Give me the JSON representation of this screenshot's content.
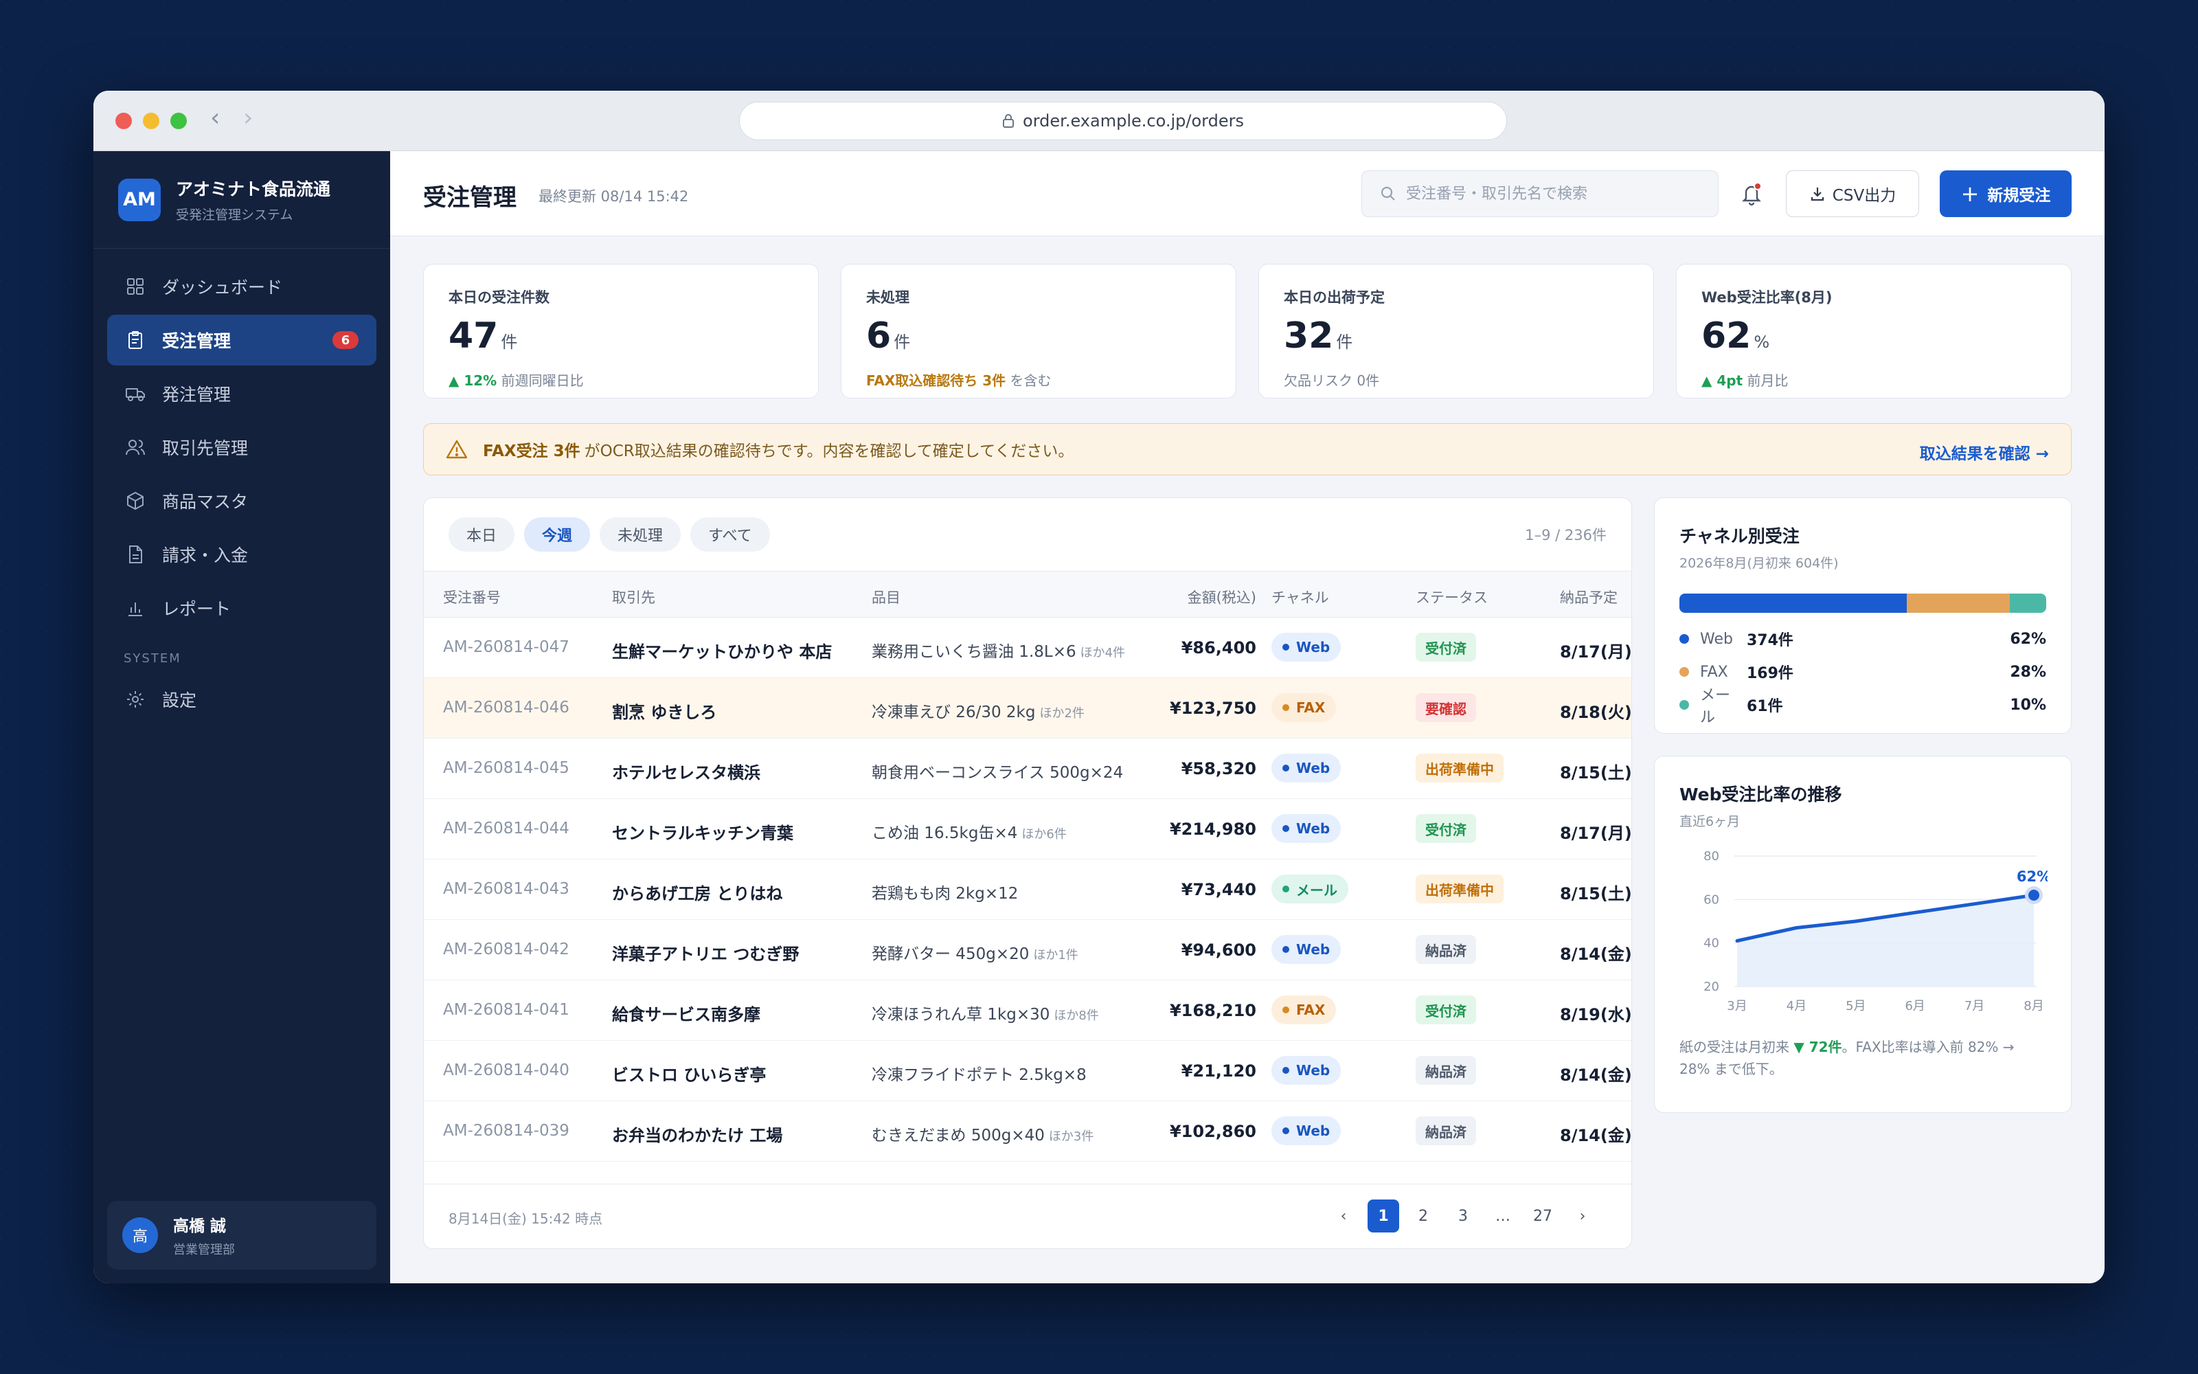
{
  "browser": {
    "url": "order.example.co.jp/orders"
  },
  "brand": {
    "logo": "AM",
    "name": "アオミナト食品流通",
    "subtitle": "受発注管理システム"
  },
  "nav": {
    "items": [
      {
        "label": "ダッシュボード",
        "icon": "grid-icon"
      },
      {
        "label": "受注管理",
        "icon": "clipboard-icon",
        "badge": "6"
      },
      {
        "label": "発注管理",
        "icon": "truck-icon"
      },
      {
        "label": "取引先管理",
        "icon": "users-icon"
      },
      {
        "label": "商品マスタ",
        "icon": "box-icon"
      },
      {
        "label": "請求・入金",
        "icon": "document-icon"
      },
      {
        "label": "レポート",
        "icon": "bar-chart-icon"
      }
    ],
    "section_label": "SYSTEM",
    "settings_label": "設定"
  },
  "user": {
    "avatar": "高",
    "name": "高橋 誠",
    "dept": "営業管理部"
  },
  "header": {
    "title": "受注管理",
    "updated": "最終更新 08/14 15:42",
    "search_placeholder": "受注番号・取引先名で検索",
    "csv_label": "CSV出力",
    "new_label": "新規受注"
  },
  "stats": [
    {
      "label": "本日の受注件数",
      "value": "47",
      "unit": "件",
      "note_hl": "▲ 12%",
      "note": "前週同曜日比"
    },
    {
      "label": "未処理",
      "value": "6",
      "unit": "件",
      "note_hl": "FAX取込確認待ち 3件",
      "note": "を含む"
    },
    {
      "label": "本日の出荷予定",
      "value": "32",
      "unit": "件",
      "note": "欠品リスク 0件"
    },
    {
      "label": "Web受注比率(8月)",
      "value": "62",
      "unit": "%",
      "note_hl": "▲ 4pt",
      "note": "前月比"
    }
  ],
  "alert": {
    "strong": "FAX受注 3件",
    "text": "がOCR取込結果の確認待ちです。内容を確認して確定してください。",
    "link": "取込結果を確認 →"
  },
  "table": {
    "filters": [
      "本日",
      "今週",
      "未処理",
      "すべて"
    ],
    "active_filter": "今週",
    "range": "1–9 / 236件",
    "columns": [
      "受注番号",
      "取引先",
      "品目",
      "金額(税込)",
      "チャネル",
      "ステータス",
      "納品予定"
    ],
    "rows": [
      {
        "id": "AM-260814-047",
        "customer": "生鮮マーケットひかりや 本店",
        "item": "業務用こいくち醤油 1.8L×6",
        "more": "ほか4件",
        "amount": "¥86,400",
        "channel": "Web",
        "status": "受付済",
        "date": "8/17(月)"
      },
      {
        "id": "AM-260814-046",
        "customer": "割烹 ゆきしろ",
        "item": "冷凍車えび 26/30 2kg",
        "more": "ほか2件",
        "amount": "¥123,750",
        "channel": "FAX",
        "status": "要確認",
        "date": "8/18(火)"
      },
      {
        "id": "AM-260814-045",
        "customer": "ホテルセレスタ横浜",
        "item": "朝食用ベーコンスライス 500g×24",
        "more": "",
        "amount": "¥58,320",
        "channel": "Web",
        "status": "出荷準備中",
        "date": "8/15(土)"
      },
      {
        "id": "AM-260814-044",
        "customer": "セントラルキッチン青葉",
        "item": "こめ油 16.5kg缶×4",
        "more": "ほか6件",
        "amount": "¥214,980",
        "channel": "Web",
        "status": "受付済",
        "date": "8/17(月)"
      },
      {
        "id": "AM-260814-043",
        "customer": "からあげ工房 とりはね",
        "item": "若鶏もも肉 2kg×12",
        "more": "",
        "amount": "¥73,440",
        "channel": "メール",
        "status": "出荷準備中",
        "date": "8/15(土)"
      },
      {
        "id": "AM-260814-042",
        "customer": "洋菓子アトリエ つむぎ野",
        "item": "発酵バター 450g×20",
        "more": "ほか1件",
        "amount": "¥94,600",
        "channel": "Web",
        "status": "納品済",
        "date": "8/14(金)"
      },
      {
        "id": "AM-260814-041",
        "customer": "給食サービス南多摩",
        "item": "冷凍ほうれん草 1kg×30",
        "more": "ほか8件",
        "amount": "¥168,210",
        "channel": "FAX",
        "status": "受付済",
        "date": "8/19(水)"
      },
      {
        "id": "AM-260814-040",
        "customer": "ビストロ ひいらぎ亭",
        "item": "冷凍フライドポテト 2.5kg×8",
        "more": "",
        "amount": "¥21,120",
        "channel": "Web",
        "status": "納品済",
        "date": "8/14(金)"
      },
      {
        "id": "AM-260814-039",
        "customer": "お弁当のわかたけ 工場",
        "item": "むきえだまめ 500g×40",
        "more": "ほか3件",
        "amount": "¥102,860",
        "channel": "Web",
        "status": "納品済",
        "date": "8/14(金)"
      }
    ],
    "as_of": "8月14日(金) 15:42 時点",
    "pages": [
      "1",
      "2",
      "3",
      "…",
      "27"
    ],
    "current_page": "1"
  },
  "channel_card": {
    "title": "チャネル別受注",
    "subtitle": "2026年8月(月初来 604件)",
    "items": [
      {
        "name": "Web",
        "count": "374件",
        "pct": "62%",
        "share": 62,
        "color": "#1a5ccf"
      },
      {
        "name": "FAX",
        "count": "169件",
        "pct": "28%",
        "share": 28,
        "color": "#e3a35a"
      },
      {
        "name": "メール",
        "count": "61件",
        "pct": "10%",
        "share": 10,
        "color": "#4bb8a6"
      }
    ]
  },
  "trend_card": {
    "title": "Web受注比率の推移",
    "subtitle": "直近6ヶ月",
    "note_pre": "紙の受注は月初来",
    "note_hl": "▼ 72件",
    "note_post": "。FAX比率は導入前 82% → 28% まで低下。"
  },
  "chart_data": {
    "type": "area",
    "title": "Web受注比率の推移",
    "categories": [
      "3月",
      "4月",
      "5月",
      "6月",
      "7月",
      "8月"
    ],
    "series": [
      {
        "values": [
          41,
          47,
          50,
          54,
          58,
          62
        ]
      }
    ],
    "ylim": [
      20,
      80
    ],
    "yticks": [
      20,
      40,
      60,
      80
    ],
    "annotation": "62%",
    "color": "#1a5ccf",
    "grid": true
  }
}
